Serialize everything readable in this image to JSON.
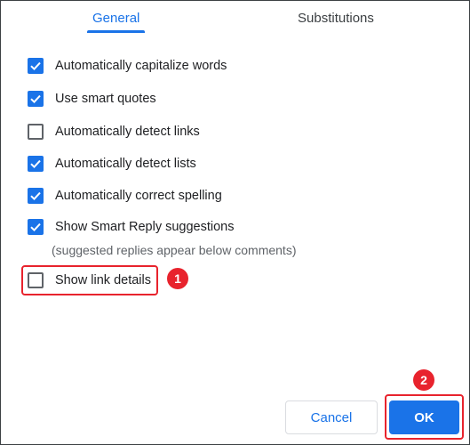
{
  "tabs": [
    {
      "label": "General",
      "active": true
    },
    {
      "label": "Substitutions",
      "active": false
    }
  ],
  "options": [
    {
      "label": "Automatically capitalize words",
      "checked": true
    },
    {
      "label": "Use smart quotes",
      "checked": true
    },
    {
      "label": "Automatically detect links",
      "checked": false
    },
    {
      "label": "Automatically detect lists",
      "checked": true
    },
    {
      "label": "Automatically correct spelling",
      "checked": true
    },
    {
      "label": "Show Smart Reply suggestions",
      "checked": true
    },
    {
      "label": "Show link details",
      "checked": false
    }
  ],
  "smart_reply_note": "(suggested replies appear below comments)",
  "annotations": {
    "badge_1": "1",
    "badge_2": "2"
  },
  "buttons": {
    "cancel": "Cancel",
    "ok": "OK"
  },
  "colors": {
    "accent": "#1a73e8",
    "highlight": "#e8232d"
  }
}
